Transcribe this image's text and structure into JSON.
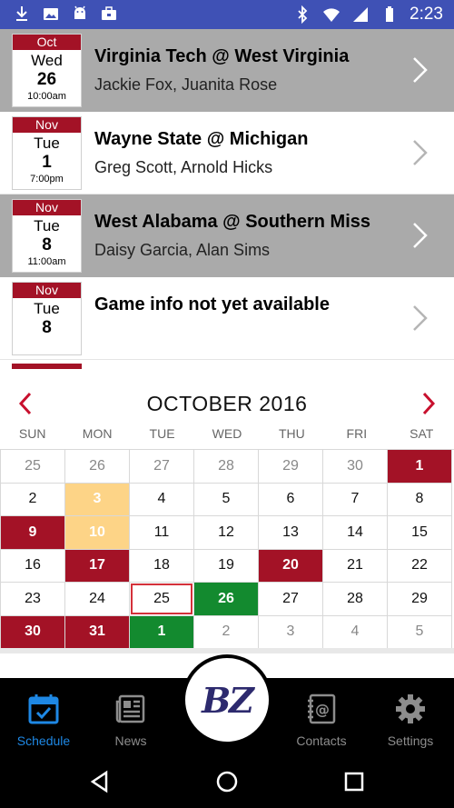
{
  "status_bar": {
    "time": "2:23",
    "left_icons": [
      "download-icon",
      "photo-icon",
      "android-icon",
      "briefcase-icon"
    ],
    "right_icons": [
      "bluetooth-icon",
      "wifi-icon",
      "signal-icon",
      "battery-icon"
    ]
  },
  "games": [
    {
      "month": "Oct",
      "dow": "Wed",
      "day": "26",
      "time": "10:00am",
      "title": "Virginia Tech @ West Virginia",
      "officials": "Jackie Fox, Juanita Rose",
      "shade": "gray"
    },
    {
      "month": "Nov",
      "dow": "Tue",
      "day": "1",
      "time": "7:00pm",
      "title": "Wayne State @ Michigan",
      "officials": "Greg Scott, Arnold Hicks",
      "shade": "white"
    },
    {
      "month": "Nov",
      "dow": "Tue",
      "day": "8",
      "time": "11:00am",
      "title": "West Alabama @ Southern Miss",
      "officials": "Daisy Garcia, Alan Sims",
      "shade": "gray"
    },
    {
      "month": "Nov",
      "dow": "Tue",
      "day": "8",
      "time": "",
      "title": "Game info not yet available",
      "officials": "",
      "shade": "white"
    }
  ],
  "calendar": {
    "title": "OCTOBER 2016",
    "weekdays": [
      "SUN",
      "MON",
      "TUE",
      "WED",
      "THU",
      "FRI",
      "SAT"
    ],
    "colors": {
      "red": "#a31226",
      "yellow": "#fdd487",
      "green": "#138a2f",
      "today_outline": "#d4313a"
    },
    "days": [
      {
        "n": "25",
        "muted": true
      },
      {
        "n": "26",
        "muted": true
      },
      {
        "n": "27",
        "muted": true
      },
      {
        "n": "28",
        "muted": true
      },
      {
        "n": "29",
        "muted": true
      },
      {
        "n": "30",
        "muted": true
      },
      {
        "n": "1",
        "status": "red"
      },
      {
        "n": "2"
      },
      {
        "n": "3",
        "status": "yellow"
      },
      {
        "n": "4"
      },
      {
        "n": "5"
      },
      {
        "n": "6"
      },
      {
        "n": "7"
      },
      {
        "n": "8"
      },
      {
        "n": "9",
        "status": "red"
      },
      {
        "n": "10",
        "status": "yellow"
      },
      {
        "n": "11"
      },
      {
        "n": "12"
      },
      {
        "n": "13"
      },
      {
        "n": "14"
      },
      {
        "n": "15"
      },
      {
        "n": "16"
      },
      {
        "n": "17",
        "status": "red"
      },
      {
        "n": "18"
      },
      {
        "n": "19"
      },
      {
        "n": "20",
        "status": "red"
      },
      {
        "n": "21"
      },
      {
        "n": "22"
      },
      {
        "n": "23"
      },
      {
        "n": "24"
      },
      {
        "n": "25",
        "today": true
      },
      {
        "n": "26",
        "status": "green"
      },
      {
        "n": "27"
      },
      {
        "n": "28"
      },
      {
        "n": "29"
      },
      {
        "n": "30",
        "status": "red"
      },
      {
        "n": "31",
        "status": "red"
      },
      {
        "n": "1",
        "status": "green"
      },
      {
        "n": "2",
        "muted": true
      },
      {
        "n": "3",
        "muted": true
      },
      {
        "n": "4",
        "muted": true
      },
      {
        "n": "5",
        "muted": true
      }
    ]
  },
  "bottom_nav": {
    "schedule": "Schedule",
    "news": "News",
    "contacts": "Contacts",
    "settings": "Settings",
    "active": "schedule",
    "active_color": "#1e88e5"
  },
  "logo": {
    "text": "BZ"
  }
}
